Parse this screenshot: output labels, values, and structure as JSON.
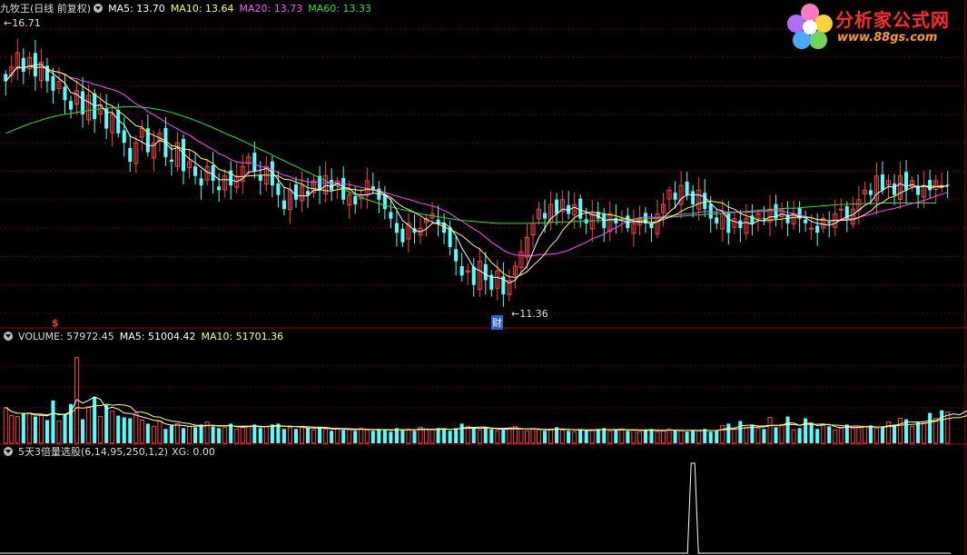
{
  "price_panel": {
    "title": "九牧王(日线 前复权)",
    "ma5": "MA5: 13.70",
    "ma10": "MA10: 13.64",
    "ma20": "MA20: 13.73",
    "ma60": "MA60: 13.33",
    "high_label": "16.71",
    "low_label": "11.36",
    "event_marker": "财",
    "dividend_marker": "$"
  },
  "volume_panel": {
    "title": "VOLUME: 57972.45",
    "ma5": "MA5: 51004.42",
    "ma10": "MA10: 51701.36"
  },
  "indicator_panel": {
    "title": "5天3倍量选股(6,14,95,250,1,2)",
    "xg": "XG: 0.00"
  },
  "logo": {
    "name": "分析家公式网",
    "url": "www.88gs.com"
  },
  "colors": {
    "up": "#ff4040",
    "down": "#54ffff",
    "ma5": "#ffffff",
    "ma10": "#ffff66",
    "ma20": "#ff4dff",
    "ma60": "#33dd33",
    "grid": "#6a0000",
    "separator": "#a00000"
  },
  "chart_data": {
    "type": "candlestick",
    "price_ylim": [
      11.0,
      17.0
    ],
    "close": [
      15.9,
      16.2,
      16.5,
      16.1,
      16.4,
      16.0,
      16.3,
      15.9,
      15.7,
      15.9,
      15.5,
      15.3,
      15.7,
      15.2,
      15.6,
      15.1,
      15.4,
      14.9,
      15.2,
      14.8,
      14.6,
      14.2,
      14.6,
      14.9,
      14.4,
      14.6,
      14.8,
      14.3,
      14.2,
      14.6,
      14.0,
      14.2,
      13.9,
      13.7,
      14.1,
      13.8,
      13.6,
      13.9,
      13.7,
      13.9,
      14.1,
      14.3,
      14.0,
      13.8,
      14.1,
      13.7,
      13.5,
      13.2,
      13.6,
      13.4,
      13.7,
      13.5,
      13.8,
      13.6,
      13.9,
      13.6,
      13.8,
      13.4,
      13.5,
      13.3,
      13.5,
      13.8,
      13.6,
      13.4,
      13.2,
      13.0,
      12.7,
      12.5,
      12.9,
      12.7,
      12.8,
      13.0,
      13.1,
      12.9,
      12.7,
      12.4,
      12.1,
      11.8,
      11.9,
      11.6,
      12.1,
      11.7,
      11.5,
      11.9,
      11.4,
      11.7,
      12.0,
      12.3,
      12.6,
      12.9,
      13.2,
      13.0,
      13.3,
      13.1,
      13.4,
      13.1,
      13.3,
      13.0,
      12.9,
      13.1,
      13.0,
      12.8,
      13.1,
      12.9,
      13.0,
      12.8,
      12.9,
      13.0,
      12.9,
      12.8,
      13.1,
      13.3,
      13.6,
      13.4,
      13.7,
      13.5,
      13.3,
      13.6,
      13.2,
      13.0,
      12.9,
      13.1,
      12.7,
      13.0,
      12.8,
      13.0,
      12.9,
      13.1,
      13.0,
      13.2,
      13.0,
      13.2,
      12.9,
      13.1,
      13.0,
      12.9,
      12.8,
      12.7,
      13.0,
      12.9,
      13.1,
      13.2,
      13.0,
      13.2,
      13.4,
      13.6,
      13.5,
      13.9,
      13.6,
      13.8,
      13.5,
      13.9,
      13.6,
      13.8,
      13.5,
      13.7,
      13.6,
      13.8,
      13.7,
      13.7
    ],
    "ma60": [
      14.8,
      14.85,
      14.9,
      14.95,
      15.0,
      15.04,
      15.08,
      15.12,
      15.15,
      15.18,
      15.2,
      15.22,
      15.24,
      15.26,
      15.28,
      15.3,
      15.32,
      15.33,
      15.34,
      15.35,
      15.36,
      15.36,
      15.36,
      15.35,
      15.34,
      15.32,
      15.3,
      15.27,
      15.24,
      15.2,
      15.16,
      15.12,
      15.07,
      15.02,
      14.97,
      14.92,
      14.86,
      14.8,
      14.75,
      14.7,
      14.64,
      14.58,
      14.52,
      14.46,
      14.4,
      14.34,
      14.28,
      14.22,
      14.16,
      14.1,
      14.04,
      13.98,
      13.92,
      13.86,
      13.8,
      13.74,
      13.68,
      13.62,
      13.56,
      13.5,
      13.45,
      13.4,
      13.36,
      13.32,
      13.28,
      13.25,
      13.22,
      13.19,
      13.16,
      13.13,
      13.1,
      13.08,
      13.06,
      13.04,
      13.02,
      13.0,
      12.98,
      12.96,
      12.95,
      12.94,
      12.93,
      12.92,
      12.91,
      12.9,
      12.9,
      12.9,
      12.9,
      12.9,
      12.9,
      12.9,
      12.91,
      12.91,
      12.92,
      12.92,
      12.93,
      12.93,
      12.94,
      12.94,
      12.95,
      12.95,
      12.96,
      12.96,
      12.97,
      12.97,
      12.98,
      12.98,
      12.99,
      12.99,
      13.0,
      13.0,
      13.01,
      13.02,
      13.03,
      13.04,
      13.05,
      13.06,
      13.07,
      13.08,
      13.09,
      13.1,
      13.1,
      13.11,
      13.12,
      13.13,
      13.14,
      13.15,
      13.16,
      13.17,
      13.18,
      13.19,
      13.2,
      13.21,
      13.22,
      13.22,
      13.23,
      13.24,
      13.25,
      13.26,
      13.27,
      13.28,
      13.29,
      13.3,
      13.3,
      13.31,
      13.31,
      13.32,
      13.32,
      13.32,
      13.33,
      13.33,
      13.33,
      13.33,
      13.33,
      13.33,
      13.33,
      13.33,
      13.33,
      13.33
    ],
    "volume": [
      40,
      31,
      30,
      33,
      34,
      30,
      31,
      26,
      48,
      25,
      33,
      44,
      96,
      27,
      41,
      52,
      30,
      43,
      36,
      31,
      29,
      28,
      34,
      26,
      22,
      19,
      25,
      16,
      20,
      22,
      17,
      19,
      18,
      21,
      24,
      19,
      17,
      18,
      22,
      16,
      18,
      19,
      21,
      17,
      19,
      21,
      22,
      16,
      18,
      16,
      19,
      17,
      15,
      18,
      16,
      14,
      17,
      15,
      16,
      14,
      17,
      15,
      14,
      16,
      15,
      13,
      17,
      15,
      16,
      14,
      18,
      16,
      15,
      17,
      16,
      14,
      17,
      22,
      19,
      17,
      15,
      18,
      16,
      14,
      15,
      17,
      19,
      16,
      14,
      16,
      15,
      14,
      16,
      18,
      15,
      14,
      13,
      16,
      14,
      15,
      16,
      17,
      14,
      15,
      16,
      14,
      15,
      13,
      15,
      16,
      13,
      14,
      16,
      15,
      14,
      13,
      15,
      14,
      16,
      13,
      14,
      20,
      22,
      16,
      25,
      18,
      21,
      17,
      16,
      29,
      18,
      21,
      30,
      15,
      17,
      28,
      23,
      16,
      20,
      19,
      15,
      17,
      21,
      17,
      18,
      19,
      20,
      17,
      18,
      24,
      21,
      28,
      27,
      19,
      24,
      23,
      34,
      28,
      37,
      35,
      31,
      29,
      45,
      56,
      38,
      30,
      47,
      35,
      43
    ],
    "vol_ylim": [
      0,
      110
    ],
    "xg_signal_index": 116,
    "xg_ylim": [
      0,
      1
    ],
    "grid": true
  }
}
